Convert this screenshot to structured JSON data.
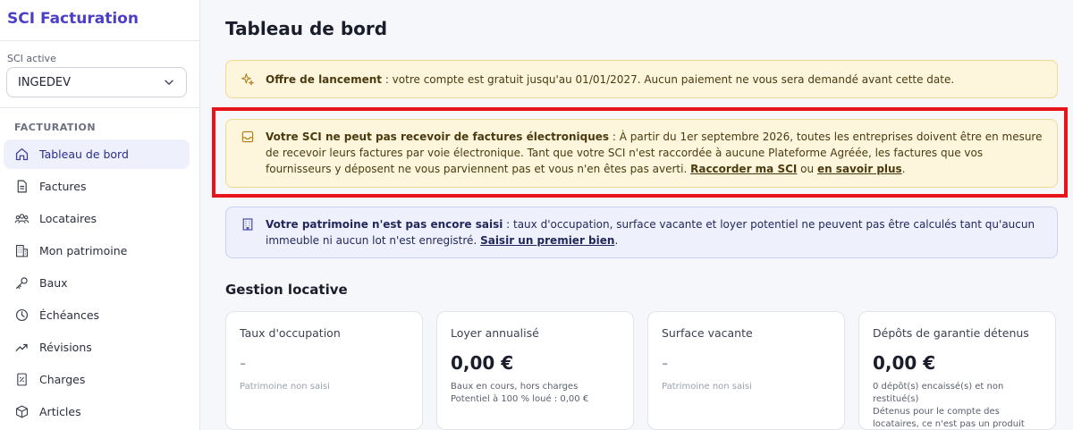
{
  "sidebar": {
    "brand": "SCI Facturation",
    "sci_label": "SCI active",
    "sci_selected": "INGEDEV",
    "section_label": "FACTURATION",
    "items": [
      {
        "label": "Tableau de bord",
        "icon": "home-icon",
        "active": true
      },
      {
        "label": "Factures",
        "icon": "document-icon"
      },
      {
        "label": "Locataires",
        "icon": "users-icon"
      },
      {
        "label": "Mon patrimoine",
        "icon": "building-icon"
      },
      {
        "label": "Baux",
        "icon": "key-icon"
      },
      {
        "label": "Échéances",
        "icon": "clock-icon"
      },
      {
        "label": "Révisions",
        "icon": "trend-icon"
      },
      {
        "label": "Charges",
        "icon": "receipt-icon"
      },
      {
        "label": "Articles",
        "icon": "box-icon"
      }
    ]
  },
  "main": {
    "title": "Tableau de bord",
    "alerts": {
      "launch": {
        "title": "Offre de lancement",
        "text": " : votre compte est gratuit jusqu'au 01/01/2027. Aucun paiement ne vous sera demandé avant cette date."
      },
      "einvoice": {
        "title": "Votre SCI ne peut pas recevoir de factures électroniques",
        "text": " : À partir du 1er septembre 2026, toutes les entreprises doivent être en mesure de recevoir leurs factures par voie électronique. Tant que votre SCI n'est raccordée à aucune Plateforme Agréée, les factures que vos fournisseurs y déposent ne vous parviennent pas et vous n'en êtes pas averti. ",
        "link1": "Raccorder ma SCI",
        "between": " ou ",
        "link2": "en savoir plus",
        "end": "."
      },
      "patrimoine": {
        "title": "Votre patrimoine n'est pas encore saisi",
        "text": " : taux d'occupation, surface vacante et loyer potentiel ne peuvent pas être calculés tant qu'aucun immeuble ni aucun lot n'est enregistré. ",
        "link": "Saisir un premier bien",
        "end": "."
      }
    },
    "section_title": "Gestion locative",
    "cards": [
      {
        "label": "Taux d'occupation",
        "value": "-",
        "sub1": "Patrimoine non saisi",
        "sub2": ""
      },
      {
        "label": "Loyer annualisé",
        "value": "0,00 €",
        "sub1": "Baux en cours, hors charges",
        "sub2": "Potentiel à 100 % loué : 0,00 €"
      },
      {
        "label": "Surface vacante",
        "value": "-",
        "sub1": "Patrimoine non saisi",
        "sub2": ""
      },
      {
        "label": "Dépôts de garantie détenus",
        "value": "0,00 €",
        "sub1": "0 dépôt(s) encaissé(s) et non restitué(s)",
        "sub2": "Détenus pour le compte des locataires, ce n'est pas un produit"
      }
    ]
  },
  "colors": {
    "brand": "#4c3fc7",
    "highlight": "#e8141c",
    "warning_bg": "#fdf6dd",
    "info_bg": "#eef1fc"
  }
}
